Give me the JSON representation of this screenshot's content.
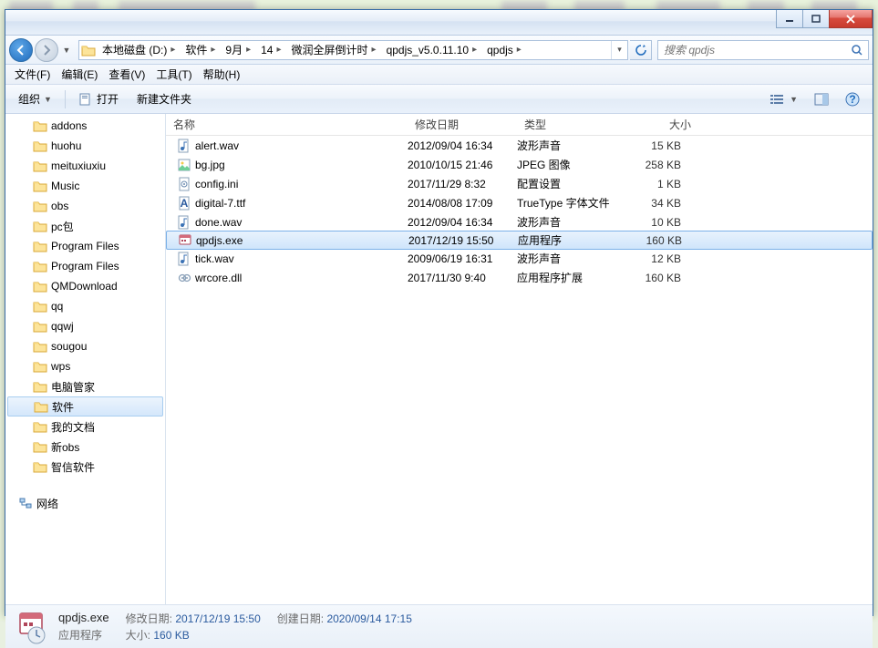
{
  "breadcrumbs": [
    "本地磁盘 (D:)",
    "软件",
    "9月",
    "14",
    "微润全屏倒计时",
    "qpdjs_v5.0.11.10",
    "qpdjs"
  ],
  "search_placeholder": "搜索 qpdjs",
  "menus": {
    "file": "文件(F)",
    "edit": "编辑(E)",
    "view": "查看(V)",
    "tools": "工具(T)",
    "help": "帮助(H)"
  },
  "toolbar": {
    "organize": "组织",
    "open": "打开",
    "newfolder": "新建文件夹"
  },
  "columns": {
    "name": "名称",
    "date": "修改日期",
    "type": "类型",
    "size": "大小"
  },
  "tree": [
    {
      "label": "addons"
    },
    {
      "label": "huohu"
    },
    {
      "label": "meituxiuxiu"
    },
    {
      "label": "Music"
    },
    {
      "label": "obs"
    },
    {
      "label": "pc包"
    },
    {
      "label": "Program Files"
    },
    {
      "label": "Program Files"
    },
    {
      "label": "QMDownload"
    },
    {
      "label": "qq"
    },
    {
      "label": "qqwj"
    },
    {
      "label": "sougou"
    },
    {
      "label": "wps"
    },
    {
      "label": "电脑管家"
    },
    {
      "label": "软件",
      "selected": true
    },
    {
      "label": "我的文档"
    },
    {
      "label": "新obs"
    },
    {
      "label": "智信软件"
    }
  ],
  "tree_network": "网络",
  "files": [
    {
      "icon": "wav",
      "name": "alert.wav",
      "date": "2012/09/04 16:34",
      "type": "波形声音",
      "size": "15 KB"
    },
    {
      "icon": "jpg",
      "name": "bg.jpg",
      "date": "2010/10/15 21:46",
      "type": "JPEG 图像",
      "size": "258 KB"
    },
    {
      "icon": "ini",
      "name": "config.ini",
      "date": "2017/11/29 8:32",
      "type": "配置设置",
      "size": "1 KB"
    },
    {
      "icon": "ttf",
      "name": "digital-7.ttf",
      "date": "2014/08/08 17:09",
      "type": "TrueType 字体文件",
      "size": "34 KB"
    },
    {
      "icon": "wav",
      "name": "done.wav",
      "date": "2012/09/04 16:34",
      "type": "波形声音",
      "size": "10 KB"
    },
    {
      "icon": "exe",
      "name": "qpdjs.exe",
      "date": "2017/12/19 15:50",
      "type": "应用程序",
      "size": "160 KB",
      "selected": true
    },
    {
      "icon": "wav",
      "name": "tick.wav",
      "date": "2009/06/19 16:31",
      "type": "波形声音",
      "size": "12 KB"
    },
    {
      "icon": "dll",
      "name": "wrcore.dll",
      "date": "2017/11/30 9:40",
      "type": "应用程序扩展",
      "size": "160 KB"
    }
  ],
  "details": {
    "name": "qpdjs.exe",
    "type": "应用程序",
    "mod_label": "修改日期:",
    "mod_val": "2017/12/19 15:50",
    "size_label": "大小:",
    "size_val": "160 KB",
    "created_label": "创建日期:",
    "created_val": "2020/09/14 17:15"
  }
}
